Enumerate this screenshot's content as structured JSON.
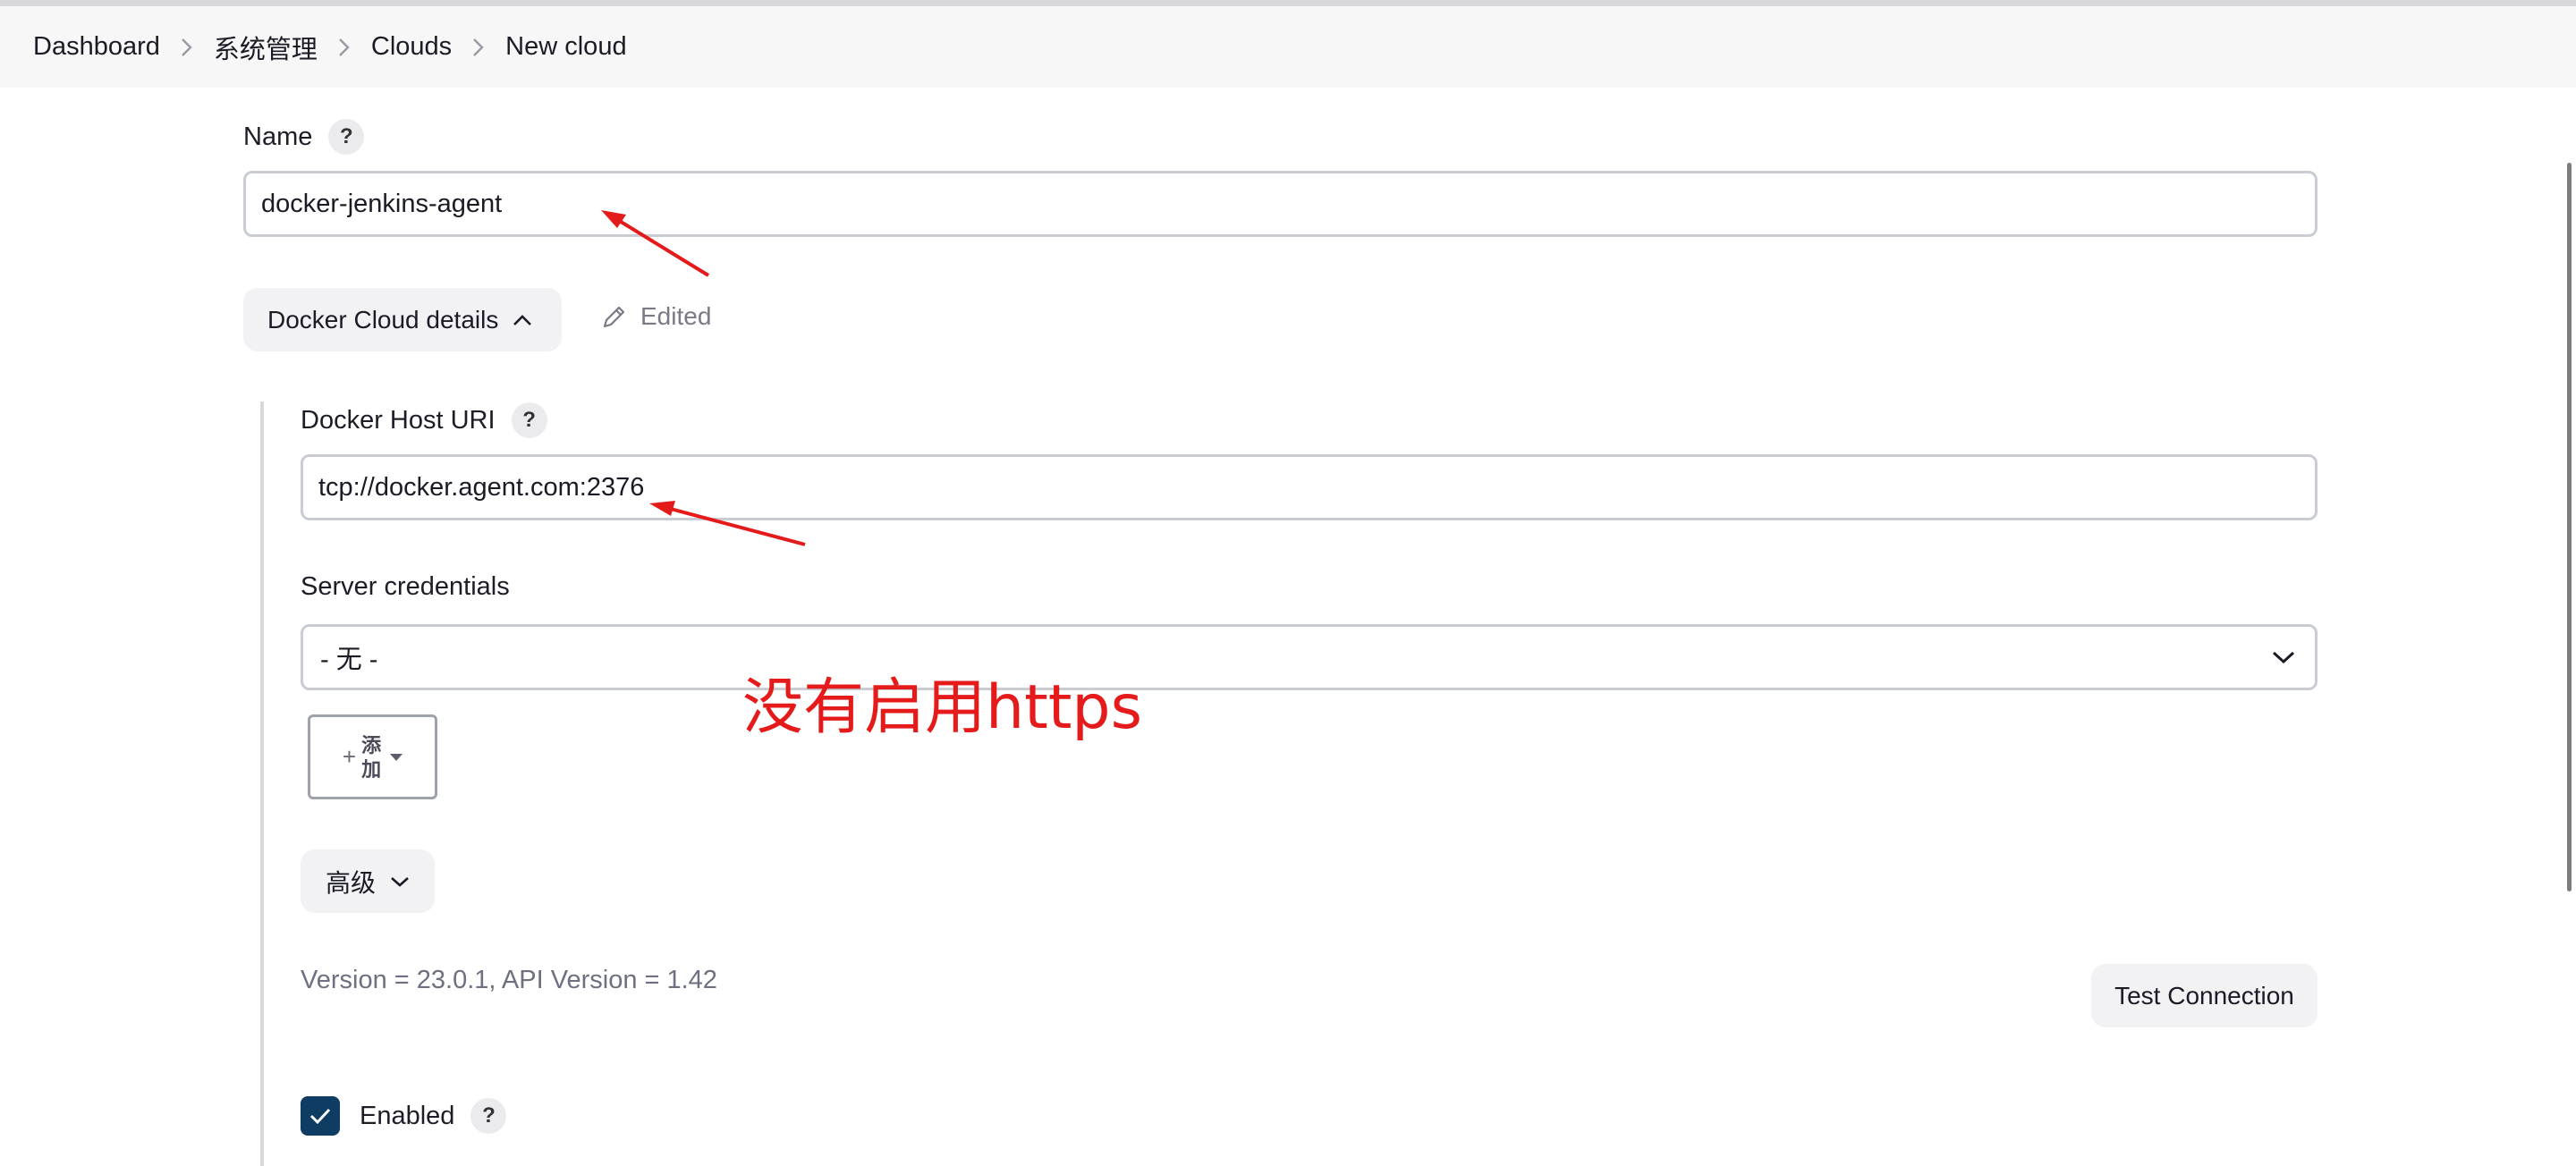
{
  "breadcrumb": [
    "Dashboard",
    "系统管理",
    "Clouds",
    "New cloud"
  ],
  "name_field": {
    "label": "Name",
    "help": "?",
    "value": "docker-jenkins-agent"
  },
  "details_toggle": {
    "label": "Docker Cloud details",
    "icon": "chevron-up-icon"
  },
  "edited_indicator": {
    "label": "Edited",
    "icon": "pencil-icon"
  },
  "docker_host": {
    "label": "Docker Host URI",
    "help": "?",
    "value": "tcp://docker.agent.com:2376"
  },
  "server_credentials": {
    "label": "Server credentials",
    "selected": "- 无 -",
    "icon": "chevron-down-icon"
  },
  "add_button": {
    "plus": "+",
    "label": "添加"
  },
  "advanced_button": {
    "label": "高级",
    "icon": "chevron-down-icon"
  },
  "version_text": "Version = 23.0.1, API Version = 1.42",
  "test_connection": "Test Connection",
  "enabled": {
    "label": "Enabled",
    "checked": true,
    "help": "?"
  },
  "annotation_text": "没有启用https",
  "colors": {
    "annotation": "#e51b1b",
    "checkbox": "#0f3c63"
  }
}
